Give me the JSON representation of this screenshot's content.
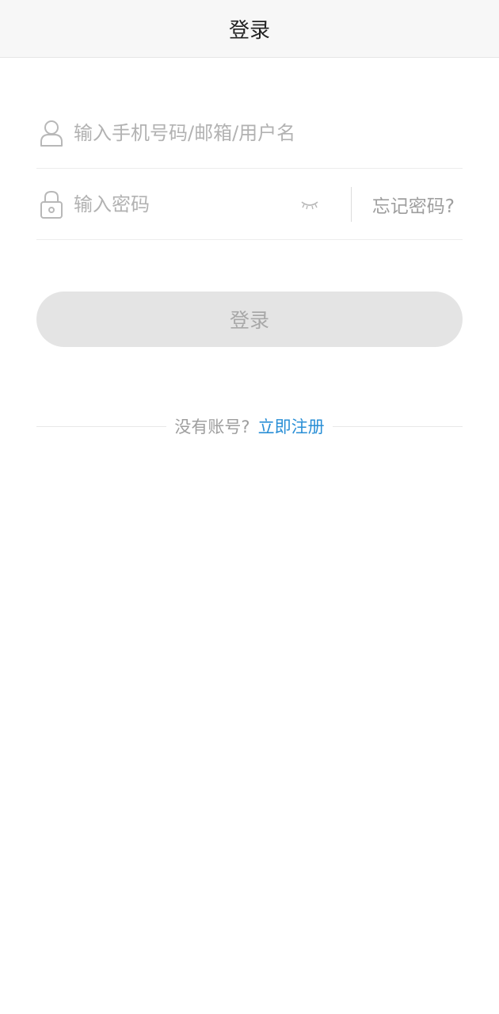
{
  "header": {
    "title": "登录"
  },
  "form": {
    "username": {
      "placeholder": "输入手机号码/邮箱/用户名",
      "value": "",
      "icon": "user-icon"
    },
    "password": {
      "placeholder": "输入密码",
      "value": "",
      "icon": "lock-icon",
      "toggle_icon": "eye-closed-icon",
      "forgot_label": "忘记密码?"
    },
    "login_label": "登录"
  },
  "register": {
    "prompt": "没有账号?",
    "link_label": "立即注册"
  },
  "colors": {
    "header_bg": "#f7f7f7",
    "placeholder": "#b2b2b2",
    "button_bg": "#e4e4e4",
    "button_text": "#a8a8a8",
    "link": "#2a8fd6"
  }
}
